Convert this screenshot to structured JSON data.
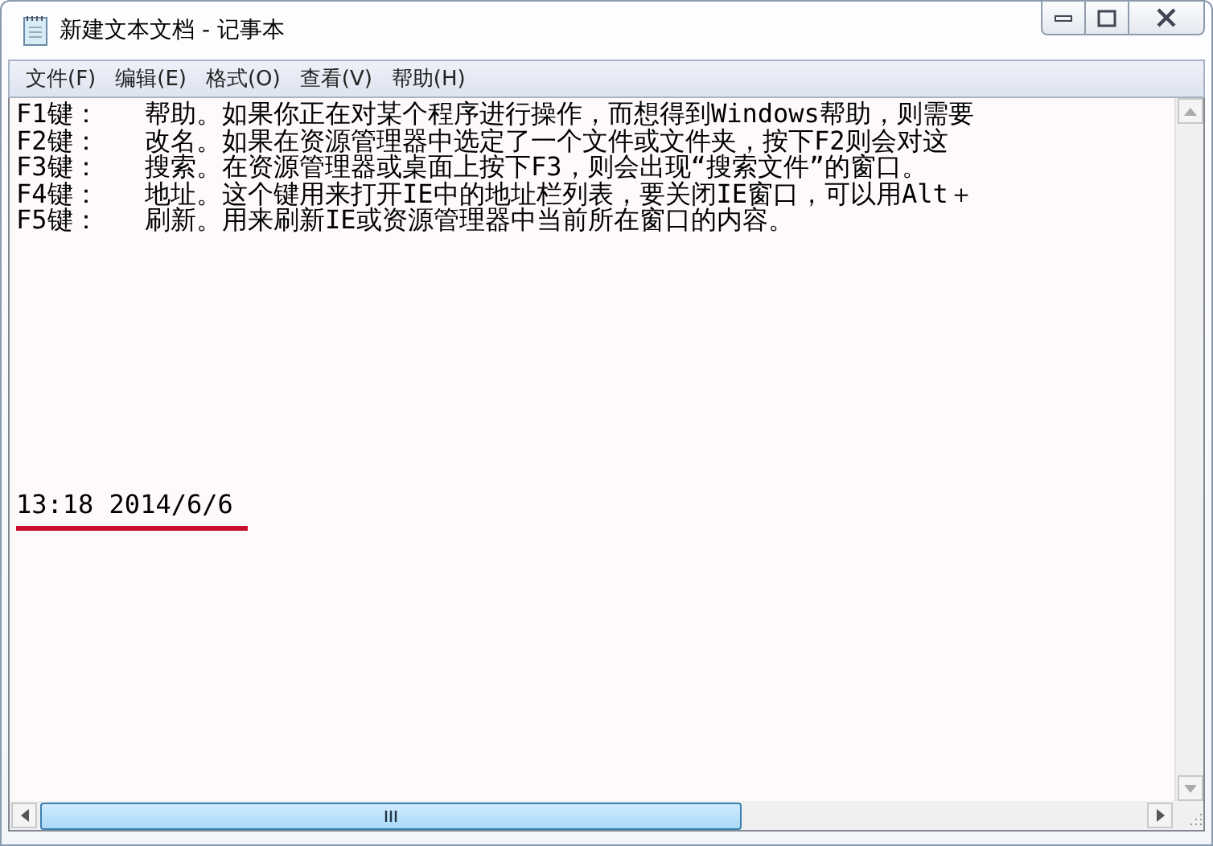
{
  "window": {
    "title": "新建文本文档 - 记事本"
  },
  "menu": [
    "文件(F)",
    "编辑(E)",
    "格式(O)",
    "查看(V)",
    "帮助(H)"
  ],
  "document": {
    "lines": [
      {
        "key": "F1键：",
        "text": "帮助。如果你正在对某个程序进行操作，而想得到Windows帮助，则需要"
      },
      {
        "key": "F2键：",
        "text": "改名。如果在资源管理器中选定了一个文件或文件夹，按下F2则会对这"
      },
      {
        "key": "F3键：",
        "text": "搜索。在资源管理器或桌面上按下F3，则会出现“搜索文件”的窗口。"
      },
      {
        "key": "F4键：",
        "text": "地址。这个键用来打开IE中的地址栏列表，要关闭IE窗口，可以用Alt＋"
      },
      {
        "key": "F5键：",
        "text": "刷新。用来刷新IE或资源管理器中当前所在窗口的内容。"
      }
    ],
    "timestamp": "13:18 2014/6/6"
  }
}
